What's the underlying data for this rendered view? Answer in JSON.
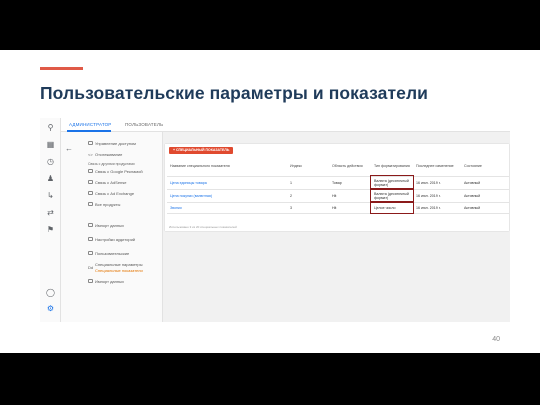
{
  "slide": {
    "title": "Пользовательские параметры и показатели",
    "page_number": "40",
    "accent_color": "#e05a47"
  },
  "screenshot": {
    "topnav": {
      "tab_admin": "АДМИНИСТРАТОР",
      "tab_user": "ПОЛЬЗОВАТЕЛЬ"
    },
    "rail_icons": [
      "search-icon",
      "dashboard-icon",
      "clock-icon",
      "person-icon",
      "share-icon",
      "flow-icon",
      "flag-icon",
      "bulb-icon",
      "gear-icon"
    ],
    "menu": {
      "items_top": [
        "Управление доступом",
        "Отслеживание"
      ],
      "section_label": "Связь с другими продуктами",
      "links": [
        "Связь с Google Рекламой",
        "Связь с AdSense",
        "Связь с Ad Exchange",
        "Все продукты"
      ],
      "items_bottom": [
        "Импорт данных",
        "Настройки аудиторий",
        "Пользовательские",
        "Специальные параметры",
        "Специальные показатели",
        "Импорт данных"
      ]
    },
    "add_button": "+ СПЕЦИАЛЬНЫЙ ПОКАЗАТЕЛЬ",
    "table": {
      "headers": [
        "Название специального показателя",
        "Индекс",
        "Область действия",
        "Тип форматирования",
        "Последнее изменение",
        "Состояние"
      ],
      "rows": [
        [
          "Цена единицы товара",
          "1",
          "Товар",
          "Валюта (десятичный формат)",
          "16 июл. 2019 г.",
          "Активный"
        ],
        [
          "Цена покупки (валютная)",
          "2",
          "Hit",
          "Валюта (десятичный формат)",
          "16 июл. 2019 г.",
          "Активный"
        ],
        [
          "Звонки",
          "3",
          "Hit",
          "Целое число",
          "16 июл. 2019 г.",
          "Активный"
        ]
      ]
    },
    "footnote": "Использовано 3 из 20 специальных показателей"
  }
}
